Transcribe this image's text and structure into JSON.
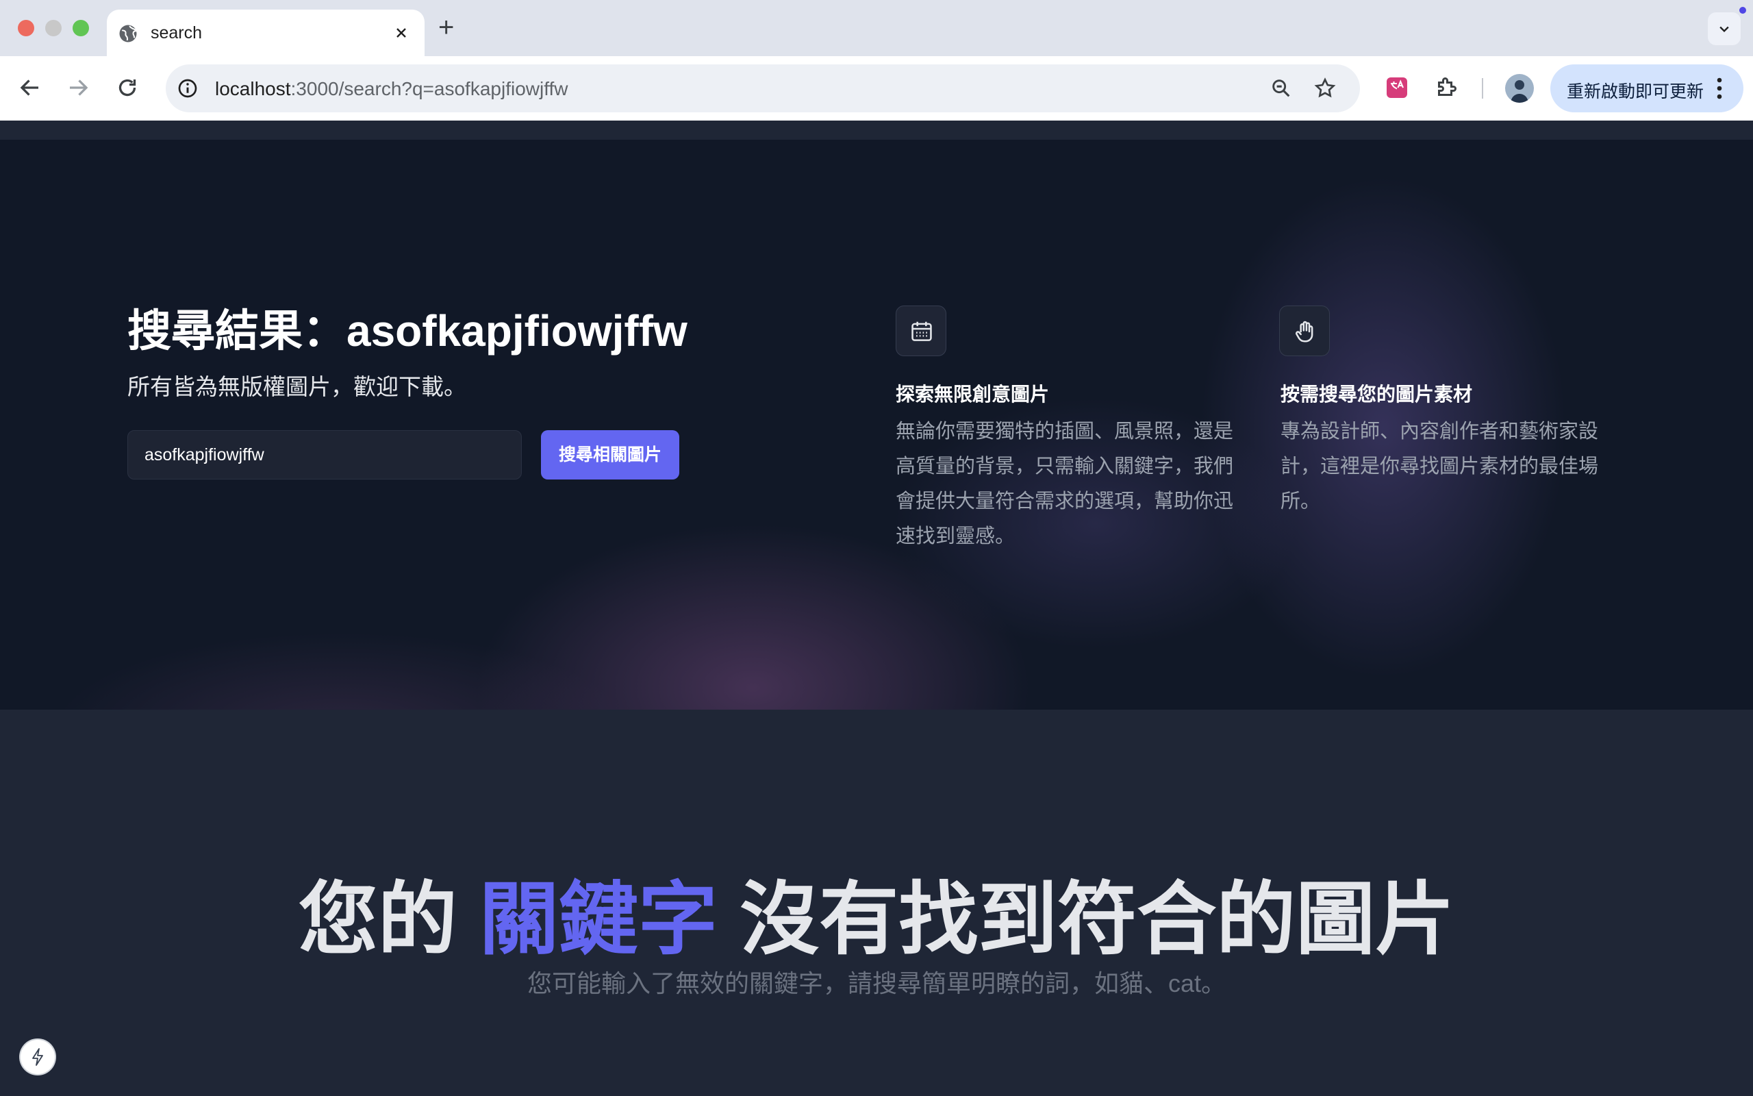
{
  "browser": {
    "tab_title": "search",
    "new_tab_label": "+",
    "url_host": "localhost",
    "url_rest": ":3000/search?q=asofkapjfiowjffw",
    "update_button_label": "重新啟動即可更新",
    "colors": {
      "tabbar": "#dfe3ec",
      "omnibox": "#edf0f5",
      "update_button": "#d3e3fd"
    }
  },
  "hero": {
    "title": "搜尋結果：asofkapjfiowjffw",
    "subtitle": "所有皆為無版權圖片，歡迎下載。",
    "search": {
      "value": "asofkapjfiowjffw",
      "button_label": "搜尋相關圖片"
    },
    "features": [
      {
        "icon": "calendar-icon",
        "title": "探索無限創意圖片",
        "description": "無論你需要獨特的插圖、風景照，還是高質量的背景，只需輸入關鍵字，我們會提供大量符合需求的選項，幫助你迅速找到靈感。"
      },
      {
        "icon": "hand-icon",
        "title": "按需搜尋您的圖片素材",
        "description": "專為設計師、內容創作者和藝術家設計，這裡是你尋找圖片素材的最佳場所。"
      }
    ]
  },
  "empty_state": {
    "heading_before": "您的",
    "heading_accent": "關鍵字",
    "heading_after": "沒有找到符合的圖片",
    "message": "您可能輸入了無效的關鍵字，請搜尋簡單明瞭的詞，如貓、cat。"
  },
  "colors": {
    "accent": "#6366f1",
    "hero_bg": "#111827",
    "page_bg": "#1f2636"
  }
}
